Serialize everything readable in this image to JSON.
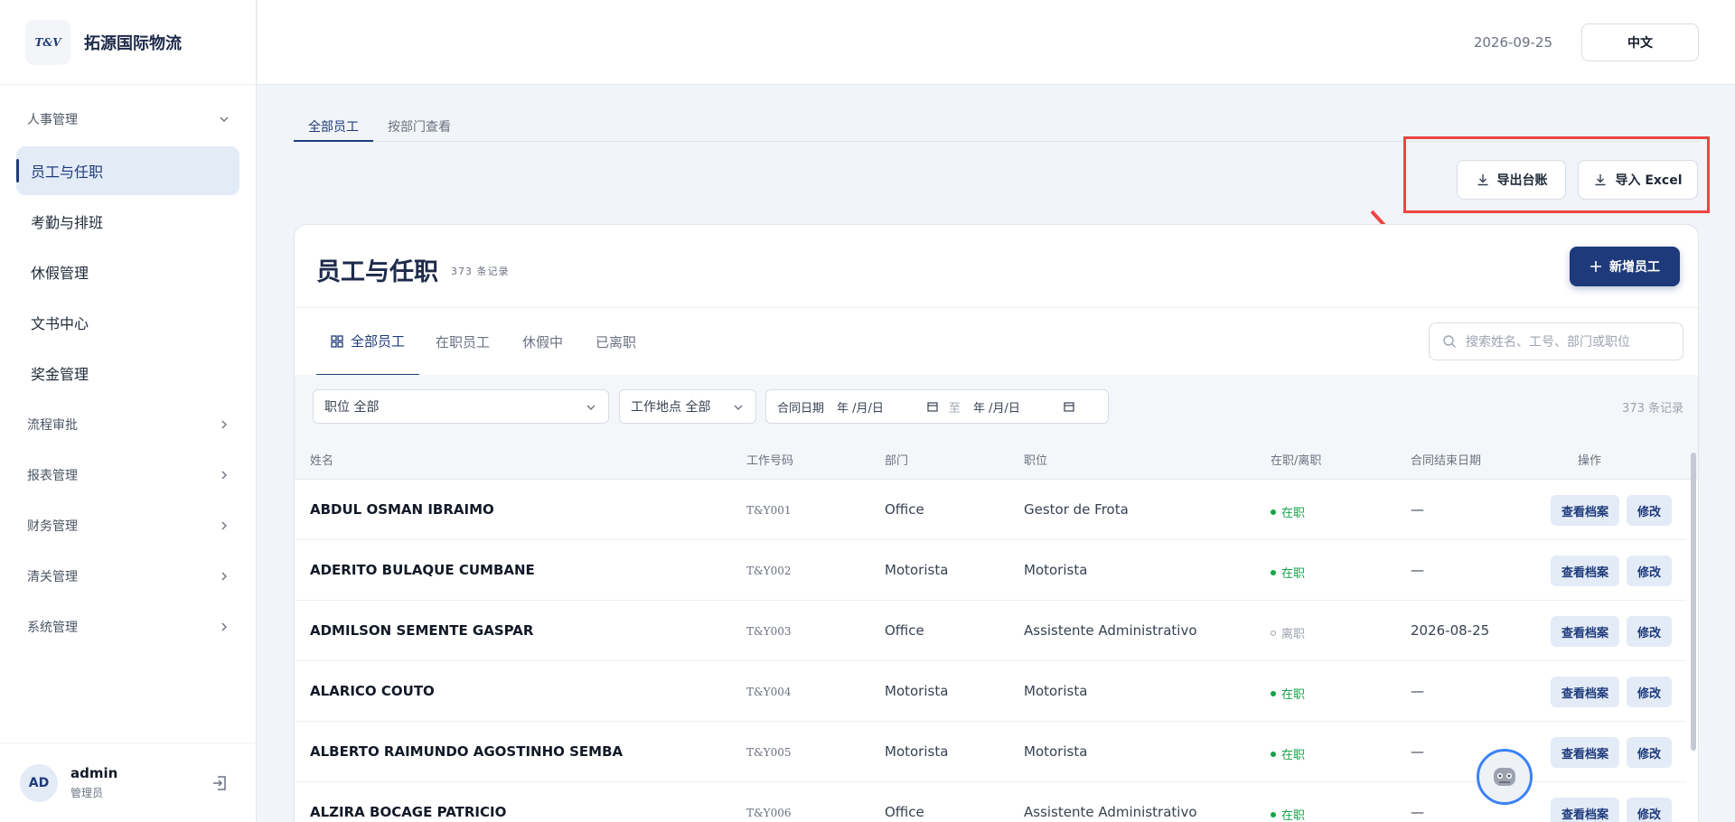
{
  "brand": {
    "logo_text": "T&V",
    "name": "拓源国际物流"
  },
  "sidebar": {
    "groups": [
      {
        "label": "人事管理",
        "expanded": true
      },
      {
        "label": "流程审批"
      },
      {
        "label": "报表管理"
      },
      {
        "label": "财务管理"
      },
      {
        "label": "清关管理"
      },
      {
        "label": "系统管理"
      }
    ],
    "items": [
      {
        "label": "员工与任职",
        "active": true
      },
      {
        "label": "考勤与排班"
      },
      {
        "label": "休假管理"
      },
      {
        "label": "文书中心"
      },
      {
        "label": "奖金管理"
      }
    ]
  },
  "user": {
    "initials": "AD",
    "name": "admin",
    "role": "管理员"
  },
  "topbar": {
    "date": "2026-09-25",
    "language": "中文"
  },
  "page_tabs": [
    "全部员工",
    "按部门查看"
  ],
  "actions": {
    "export_label": "导出台账",
    "import_label": "导入 Excel"
  },
  "card": {
    "title": "员工与任职",
    "count": "373 条记录",
    "add_label": "新增员工",
    "status_tabs": [
      "全部员工",
      "在职员工",
      "休假中",
      "已离职"
    ],
    "search_placeholder": "搜索姓名、工号、部门或职位"
  },
  "filters": {
    "position": "职位  全部",
    "location": "工作地点  全部",
    "contract_label": "合同日期",
    "date_from": "年 /月/日",
    "date_sep": "至",
    "date_to": "年 /月/日",
    "record_count": "373 条记录"
  },
  "table": {
    "headers": [
      "姓名",
      "工作号码",
      "部门",
      "职位",
      "在职/离职",
      "合同结束日期",
      "操作"
    ],
    "view_label": "查看档案",
    "edit_label": "修改",
    "rows": [
      {
        "name": "ABDUL OSMAN IBRAIMO",
        "code": "T&Y001",
        "dept": "Office",
        "position": "Gestor de Frota",
        "status": "在职",
        "active": true,
        "end": "—"
      },
      {
        "name": "ADERITO BULAQUE CUMBANE",
        "code": "T&Y002",
        "dept": "Motorista",
        "position": "Motorista",
        "status": "在职",
        "active": true,
        "end": "—"
      },
      {
        "name": "ADMILSON SEMENTE GASPAR",
        "code": "T&Y003",
        "dept": "Office",
        "position": "Assistente Administrativo",
        "status": "离职",
        "active": false,
        "end": "2026-08-25"
      },
      {
        "name": "ALARICO COUTO",
        "code": "T&Y004",
        "dept": "Motorista",
        "position": "Motorista",
        "status": "在职",
        "active": true,
        "end": "—"
      },
      {
        "name": "ALBERTO RAIMUNDO AGOSTINHO SEMBA",
        "code": "T&Y005",
        "dept": "Motorista",
        "position": "Motorista",
        "status": "在职",
        "active": true,
        "end": "—"
      },
      {
        "name": "ALZIRA BOCAGE PATRICIO",
        "code": "T&Y006",
        "dept": "Office",
        "position": "Assistente Administrativo",
        "status": "在职",
        "active": true,
        "end": "—"
      }
    ]
  },
  "colors": {
    "primary": "#1e3a7b",
    "active_status": "#16a34a",
    "inactive_status": "#9ca3af",
    "highlight": "#ef4444"
  }
}
